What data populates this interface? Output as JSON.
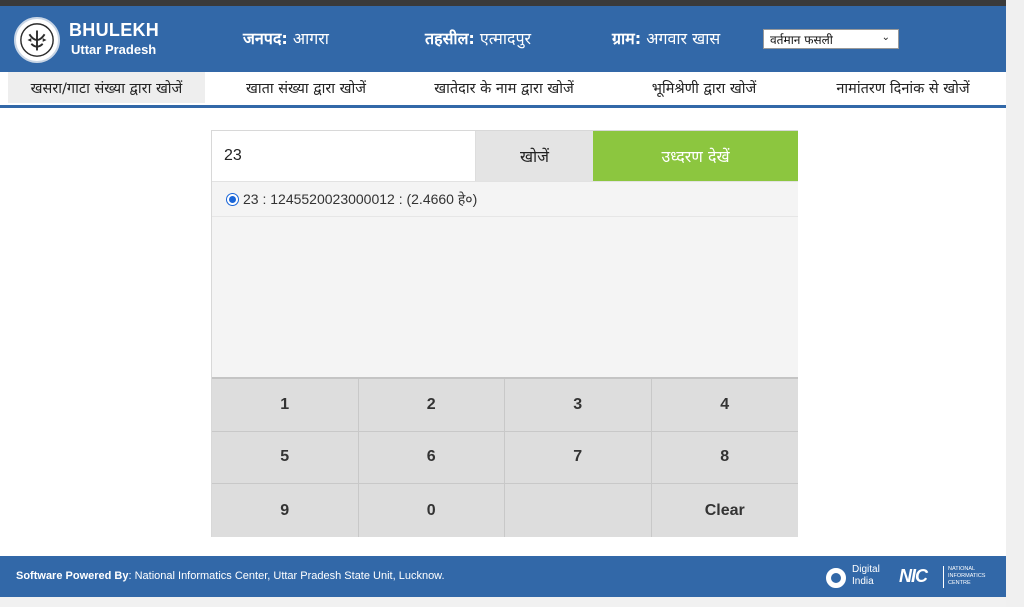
{
  "header": {
    "brand_title": "BHULEKH",
    "brand_subtitle": "Uttar Pradesh",
    "district_label": "जनपद:",
    "district_value": "आगरा",
    "tehsil_label": "तहसील:",
    "tehsil_value": "एत्मादपुर",
    "village_label": "ग्राम:",
    "village_value": "अगवार खास",
    "season_select_value": "वर्तमान फसली"
  },
  "nav": {
    "items": [
      {
        "label": "खसरा/गाटा संख्या द्वारा खोजें",
        "active": true
      },
      {
        "label": "खाता संख्या द्वारा खोजें",
        "active": false
      },
      {
        "label": "खातेदार के नाम द्वारा खोजें",
        "active": false
      },
      {
        "label": "भूमिश्रेणी द्वारा खोजें",
        "active": false
      },
      {
        "label": "नामांतरण दिनांक से खोजें",
        "active": false
      }
    ]
  },
  "search": {
    "input_value": "23",
    "search_button": "खोजें",
    "extract_button": "उध्दरण देखें"
  },
  "results": [
    {
      "text": "23 : 1245520023000012 : (2.4660 हे०)",
      "selected": true
    }
  ],
  "keypad": {
    "keys": [
      "1",
      "2",
      "3",
      "4",
      "5",
      "6",
      "7",
      "8",
      "9",
      "0",
      "",
      "Clear"
    ]
  },
  "footer": {
    "powered_label": "Software Powered By",
    "powered_text": ": National Informatics Center, Uttar Pradesh State Unit, Lucknow.",
    "digital_india_line1": "Digital",
    "digital_india_line2": "India",
    "nic_mark": "NIC",
    "nic_line1": "NATIONAL",
    "nic_line2": "INFORMATICS",
    "nic_line3": "CENTRE"
  },
  "colors": {
    "header_blue": "#3268a8",
    "extract_green": "#8cc63f",
    "keypad_grey": "#dddddd"
  }
}
